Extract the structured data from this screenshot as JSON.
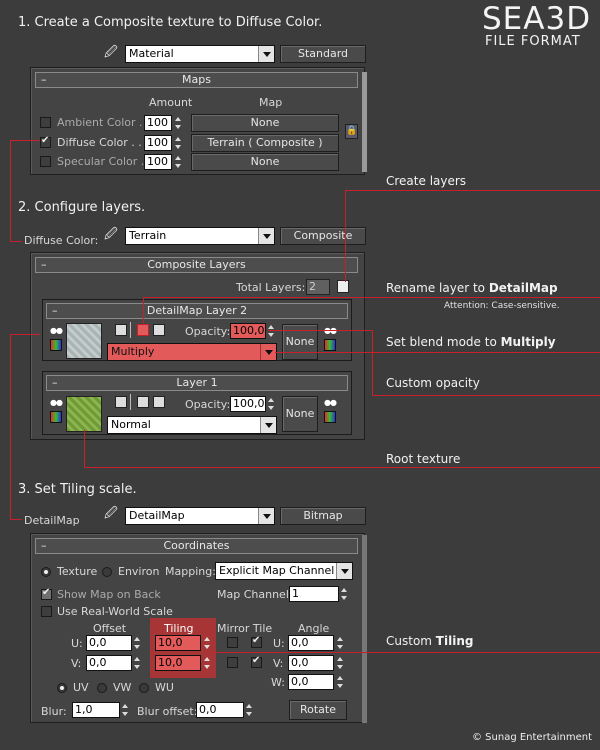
{
  "logo": {
    "line1": "SEA3D",
    "line2": "FILE FORMAT"
  },
  "copyright": "© Sunag Entertainment",
  "accent_red": "#c8202a",
  "steps": {
    "s1": "1. Create a Composite texture to Diffuse Color.",
    "s2": "2. Configure layers.",
    "s3": "3. Set Tiling scale."
  },
  "annotations": {
    "create_layers": "Create layers",
    "rename_prefix": "Rename layer to ",
    "rename_bold": "DetailMap",
    "rename_note": "Attention: Case-sensitive.",
    "blend_prefix": "Set blend mode to ",
    "blend_bold": "Multiply",
    "custom_opacity": "Custom opacity",
    "root_texture": "Root texture",
    "tiling_prefix": "Custom ",
    "tiling_bold": "Tiling"
  },
  "material": {
    "name": "Material",
    "type_button": "Standard",
    "maps_title": "Maps",
    "col_amount": "Amount",
    "col_map": "Map",
    "rows": [
      {
        "label": "Ambient Color . .",
        "amount": "100",
        "map": "None",
        "checked": false
      },
      {
        "label": "Diffuse Color . .",
        "amount": "100",
        "map": "Terrain  ( Composite )",
        "checked": true
      },
      {
        "label": "Specular Color  .",
        "amount": "100",
        "map": "None",
        "checked": false
      }
    ]
  },
  "composite": {
    "slot_label": "Diffuse Color:",
    "name": "Terrain",
    "type_button": "Composite",
    "title": "Composite Layers",
    "total_layers_label": "Total Layers:",
    "total_layers": "2",
    "layer2": {
      "title": "DetailMap Layer 2",
      "opacity_label": "Opacity:",
      "opacity": "100,0",
      "blend": "Multiply",
      "mask": "None"
    },
    "layer1": {
      "title": "Layer 1",
      "opacity_label": "Opacity:",
      "opacity": "100,0",
      "blend": "Normal",
      "mask": "None"
    }
  },
  "bitmap": {
    "slot_label": "DetailMap",
    "name": "DetailMap",
    "type_button": "Bitmap",
    "coords_title": "Coordinates",
    "texture_label": "Texture",
    "environ_label": "Environ",
    "mapping_label": "Mapping:",
    "mapping_value": "Explicit Map Channel",
    "show_map_label": "Show Map on Back",
    "real_world_label": "Use Real-World Scale",
    "map_channel_label": "Map Channel:",
    "map_channel": "1",
    "hdr_offset": "Offset",
    "hdr_tiling": "Tiling",
    "hdr_mirror_tile": "Mirror Tile",
    "hdr_angle": "Angle",
    "u_label": "U:",
    "v_label": "V:",
    "w_label": "W:",
    "u_offset": "0,0",
    "v_offset": "0,0",
    "u_tiling": "10,0",
    "v_tiling": "10,0",
    "u_angle": "0,0",
    "v_angle": "0,0",
    "w_angle": "0,0",
    "uv_label": "UV",
    "vw_label": "VW",
    "wu_label": "WU",
    "blur_label": "Blur:",
    "blur": "1,0",
    "blur_offset_label": "Blur offset:",
    "blur_offset": "0,0",
    "rotate_button": "Rotate"
  }
}
